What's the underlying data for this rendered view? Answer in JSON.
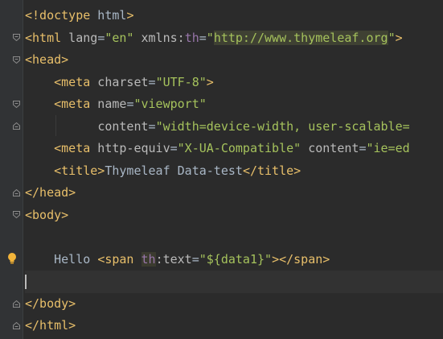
{
  "editor": {
    "colors": {
      "background": "#2b2b2b",
      "tag": "#e8bf6a",
      "attribute": "#bababa",
      "value": "#a5c25c",
      "text": "#a9b7c6",
      "namespace": "#9876aa"
    },
    "icons": {
      "fold": "fold-marker-icon",
      "bulb": "lightbulb-intention-icon"
    },
    "lines": {
      "l1": {
        "tag": "<!doctype",
        "plain": " html",
        "close": ">"
      },
      "l2": {
        "open": "<html",
        "attr1": " lang",
        "eq1": "=",
        "val1": "\"en\"",
        "attr2": " xmlns:",
        "ns": "th",
        "eq2": "=",
        "q1": "\"",
        "url": "http://www.thymeleaf.org",
        "q2": "\"",
        "close": ">"
      },
      "l3": {
        "tag": "<head>"
      },
      "l4": {
        "open": "<meta",
        "attr": " charset",
        "eq": "=",
        "val": "\"UTF-8\"",
        "close": ">"
      },
      "l5": {
        "open": "<meta",
        "attr": " name",
        "eq": "=",
        "val": "\"viewport\""
      },
      "l6": {
        "attr": "content",
        "eq": "=",
        "val": "\"width=device-width, user-scalable="
      },
      "l7": {
        "open": "<meta",
        "attr1": " http-equiv",
        "eq1": "=",
        "val1": "\"X-UA-Compatible\"",
        "attr2": " content",
        "eq2": "=",
        "val2": "\"ie=ed"
      },
      "l8": {
        "open": "<title>",
        "text": "Thymeleaf Data-test",
        "close": "</title>"
      },
      "l9": {
        "tag": "</head>"
      },
      "l10": {
        "tag": "<body>"
      },
      "l12": {
        "text": "Hello ",
        "open": "<span",
        "ns": "th",
        "attr": ":text",
        "eq": "=",
        "val": "\"${data1}\"",
        "close": "></span>"
      },
      "l14": {
        "tag": "</body>"
      },
      "l15": {
        "tag": "</html>"
      }
    }
  }
}
